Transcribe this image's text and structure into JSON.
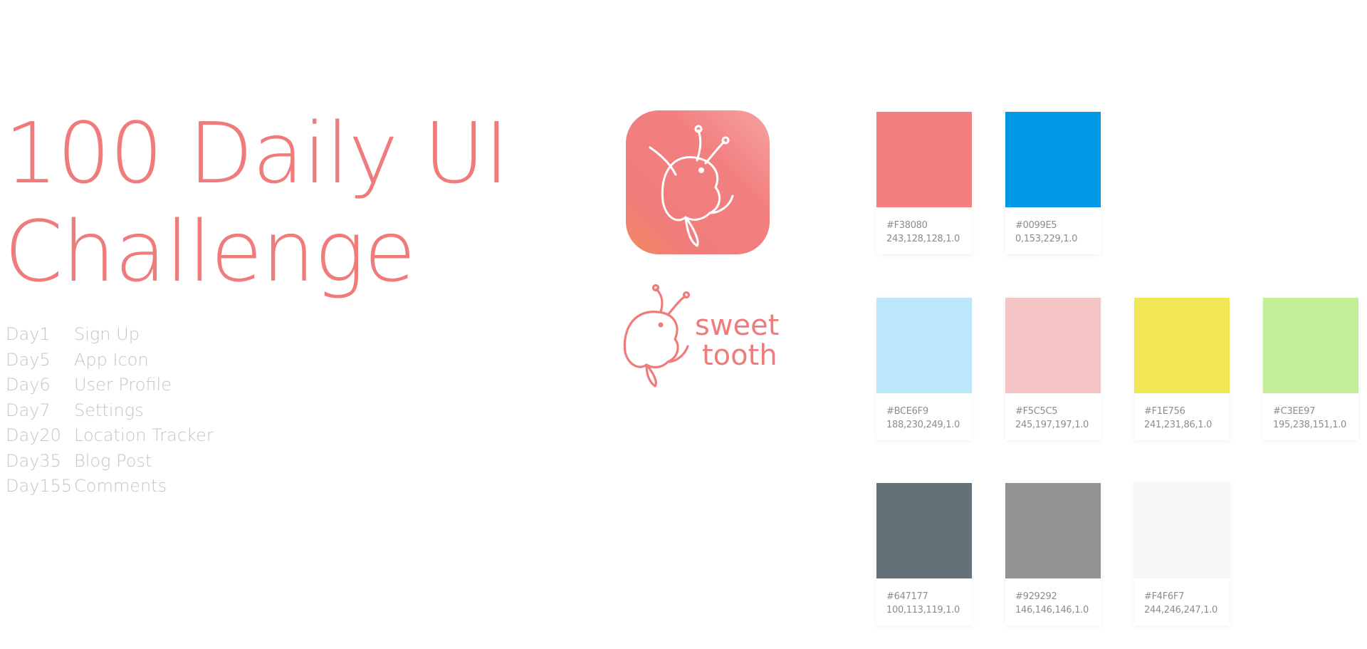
{
  "title": {
    "line1": "100 Daily UI",
    "line2": "Challenge"
  },
  "days": [
    {
      "day": "Day1",
      "label": "Sign Up"
    },
    {
      "day": "Day5",
      "label": "App Icon"
    },
    {
      "day": "Day6",
      "label": "User Profile"
    },
    {
      "day": "Day7",
      "label": "Settings"
    },
    {
      "day": "Day20",
      "label": "Location Tracker"
    },
    {
      "day": "Day35",
      "label": "Blog Post"
    },
    {
      "day": "Day155",
      "label": "Comments"
    }
  ],
  "logo": {
    "line1": "sweet",
    "line2": "tooth"
  },
  "colors": {
    "brand": "#ef7b7b",
    "icon_gradient": [
      "#f38080",
      "#f4a3a0",
      "#f1895f"
    ]
  },
  "swatches": [
    {
      "hex": "#F38080",
      "rgba": "243,128,128,1.0",
      "color": "#F38080"
    },
    {
      "hex": "#0099E5",
      "rgba": "0,153,229,1.0",
      "color": "#0099E5"
    },
    {
      "hex": "#BCE6F9",
      "rgba": "188,230,249,1.0",
      "color": "#BCE6F9"
    },
    {
      "hex": "#F5C5C5",
      "rgba": "245,197,197,1.0",
      "color": "#F5C5C5"
    },
    {
      "hex": "#F1E756",
      "rgba": "241,231,86,1.0",
      "color": "#F1E756"
    },
    {
      "hex": "#C3EE97",
      "rgba": "195,238,151,1.0",
      "color": "#C3EE97"
    },
    {
      "hex": "#647177",
      "rgba": "100,113,119,1.0",
      "color": "#647177"
    },
    {
      "hex": "#929292",
      "rgba": "146,146,146,1.0",
      "color": "#929292"
    },
    {
      "hex": "#F4F6F7",
      "rgba": "244,246,247,1.0",
      "color": "#F4F6F7"
    }
  ]
}
